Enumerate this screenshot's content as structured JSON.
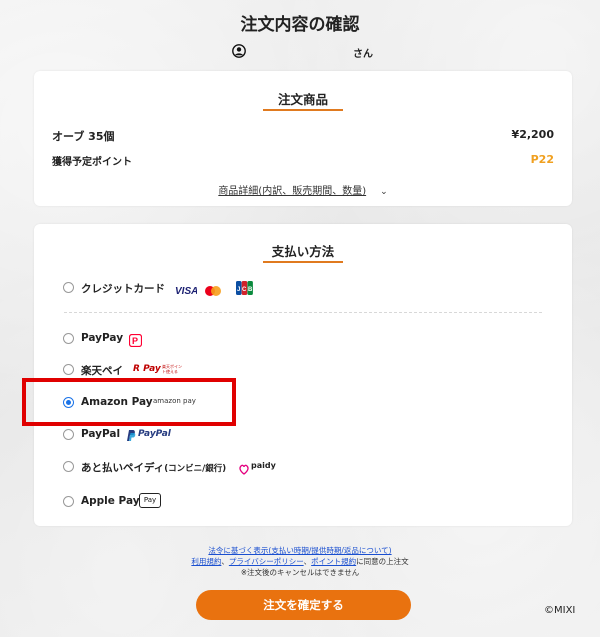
{
  "header": {
    "title": "注文内容の確認",
    "user_suffix": "さん"
  },
  "order_card": {
    "title": "注文商品",
    "item_label": "オーブ 35個",
    "item_price": "¥2,200",
    "points_label": "獲得予定ポイント",
    "points_value": "P22",
    "details_link": "商品詳細(内訳、販売期間、数量)"
  },
  "payment_card": {
    "title": "支払い方法",
    "options": [
      {
        "label": "クレジットカード",
        "selected": false,
        "logos": [
          "VISA",
          "Mastercard",
          "JCB"
        ]
      },
      {
        "label": "PayPay",
        "selected": false,
        "logo": "P"
      },
      {
        "label": "楽天ペイ",
        "selected": false,
        "logo": "R Pay",
        "logo_caption": "楽天ポイント使える"
      },
      {
        "label": "Amazon Pay",
        "selected": true,
        "logo": "amazon pay"
      },
      {
        "label": "PayPal",
        "selected": false,
        "logo": "PayPal"
      },
      {
        "label": "あと払いペイディ",
        "label_small": "(コンビニ/銀行)",
        "selected": false,
        "logo": "paidy"
      },
      {
        "label": "Apple Pay",
        "selected": false,
        "logo": "Pay"
      }
    ]
  },
  "legal": {
    "link1": "法令に基づく表示(支払い時期/提供時期/返品について)",
    "link2": "利用規約",
    "sep1": "、",
    "link3": "プライバシーポリシー",
    "sep2": "、",
    "link4": "ポイント規約",
    "suffix": "に同意の上注文",
    "note": "※注文後のキャンセルはできません"
  },
  "footer": {
    "confirm_button": "注文を確定する",
    "copyright": "©MIXI"
  },
  "colors": {
    "accent": "#e9720f",
    "selected_radio": "#1a73e8",
    "highlight": "#e00000",
    "points": "#f0a020",
    "link": "#1a4fd0"
  }
}
